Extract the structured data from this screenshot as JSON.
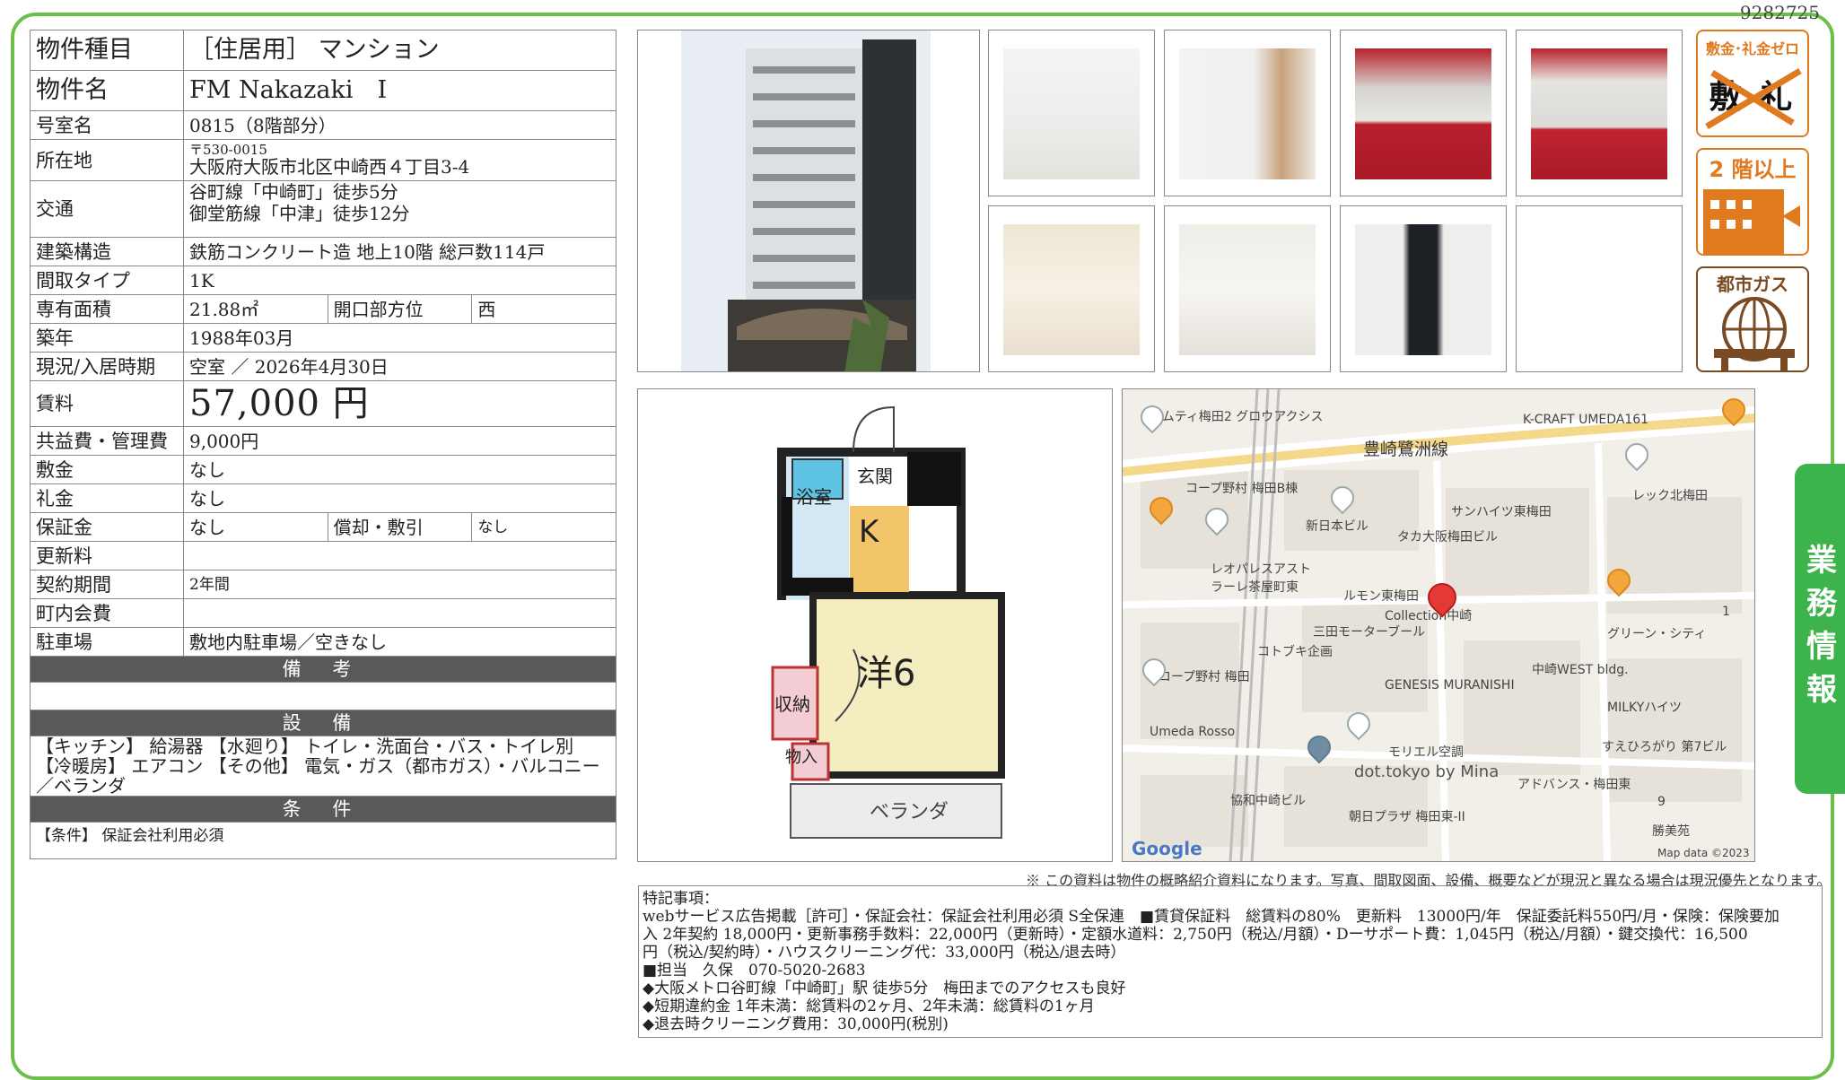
{
  "property_id": "9282725",
  "spec": {
    "type_label": "物件種目",
    "type_value": "［住居用］ マンション",
    "name_label": "物件名",
    "name_value": "FM Nakazaki　Ⅰ",
    "room_label": "号室名",
    "room_value": "0815（8階部分）",
    "address_label": "所在地",
    "postal": "〒530-0015",
    "address": "大阪府大阪市北区中崎西４丁目3-4",
    "access_label": "交通",
    "access_1": "谷町線「中崎町」徒歩5分",
    "access_2": "御堂筋線「中津」徒歩12分",
    "structure_label": "建築構造",
    "structure_value": "鉄筋コンクリート造 地上10階 総戸数114戸",
    "layout_label": "間取タイプ",
    "layout_value": "1K",
    "area_label": "専有面積",
    "area_value": "21.88㎡",
    "facing_label": "開口部方位",
    "facing_value": "西",
    "built_label": "築年",
    "built_value": "1988年03月",
    "status_label": "現況/入居時期",
    "status_value": "空室 ／ 2026年4月30日",
    "rent_label": "賃料",
    "rent_value": "57,000 円",
    "fee_label": "共益費・管理費",
    "fee_value": "9,000円",
    "deposit_label": "敷金",
    "deposit_value": "なし",
    "keymoney_label": "礼金",
    "keymoney_value": "なし",
    "guarantee_label": "保証金",
    "guarantee_value": "なし",
    "amort_label": "償却・敷引",
    "amort_value": "なし",
    "renewal_label": "更新料",
    "renewal_value": "",
    "term_label": "契約期間",
    "term_value": "2年間",
    "assoc_label": "町内会費",
    "assoc_value": "",
    "parking_label": "駐車場",
    "parking_value": "敷地内駐車場／空きなし",
    "remarks_header": "備 考",
    "equip_header": "設 備",
    "equip_text": "【キッチン】 給湯器 【水廻り】 トイレ・洗面台・バス・トイレ別 【冷暖房】 エアコン 【その他】 電気・ガス（都市ガス）・バルコニー／ベランダ",
    "cond_header": "条 件",
    "cond_text": "【条件】 保証会社利用必須"
  },
  "badges": {
    "zero": "敷金･礼金ゼロ",
    "zero_mark": "敷 礼",
    "floor": "2 階以上",
    "gas": "都市ガス"
  },
  "side_tab": "業務情報",
  "floorplan": {
    "bath": "浴室",
    "entrance": "玄関",
    "kitchen": "K",
    "room": "洋6",
    "storage": "収納",
    "closet": "物入",
    "veranda": "ベランダ"
  },
  "map": {
    "labels": [
      "サムティ梅田2 グロウアクシス",
      "K-CRAFT UMEDA161",
      "豊崎鷺洲線",
      "コープ野村 梅田B棟",
      "レック北梅田",
      "新日本ビル",
      "サンハイツ東梅田",
      "タカ大阪梅田ビル",
      "レオパレスアスト ラーレ茶屋町東",
      "ルモン東梅田",
      "Collection中崎",
      "三田モーターブール",
      "コトブキ企画",
      "グリーン・シティ",
      "コープ野村 梅田",
      "GENESIS MURANISHI",
      "中崎WEST bldg.",
      "MILKYハイツ",
      "Umeda Rosso",
      "モリエル空調",
      "すえひろがり 第7ビル",
      "dot.tokyo by Mina",
      "アドバンス・梅田東",
      "協和中崎ビル",
      "朝日プラザ 梅田東-II",
      "勝美苑",
      "Google",
      "Map data ©2023",
      "1",
      "9"
    ]
  },
  "note": "※ この資料は物件の概略紹介資料になります。写真、間取図面、設備、概要などが現況と異なる場合は現況優先となります。",
  "tokki": [
    "特記事項：",
    "webサービス広告掲載［許可］・保証会社：保証会社利用必須 S全保連　■賃貸保証料　総賃料の80%　更新料　13000円/年　保証委託料550円/月・保険：保険要加",
    "入 2年契約 18,000円・更新事務手数料：22,000円（更新時）・定額水道料：2,750円（税込/月額）・Dーサポート費：1,045円（税込/月額）・鍵交換代：16,500",
    "円（税込/契約時）・ハウスクリーニング代：33,000円（税込/退去時）",
    "■担当　久保　070-5020-2683",
    "◆大阪メトロ谷町線「中崎町」駅 徒歩5分　梅田までのアクセスも良好",
    "◆短期違約金 1年未満：総賃料の2ヶ月、2年未満：総賃料の1ヶ月",
    "◆退去時クリーニング費用：30,000円(税別)"
  ],
  "colors": {
    "frame": "#6cc04a",
    "tab": "#3cb44b",
    "badge": "#e07a1f",
    "section": "#595959"
  }
}
